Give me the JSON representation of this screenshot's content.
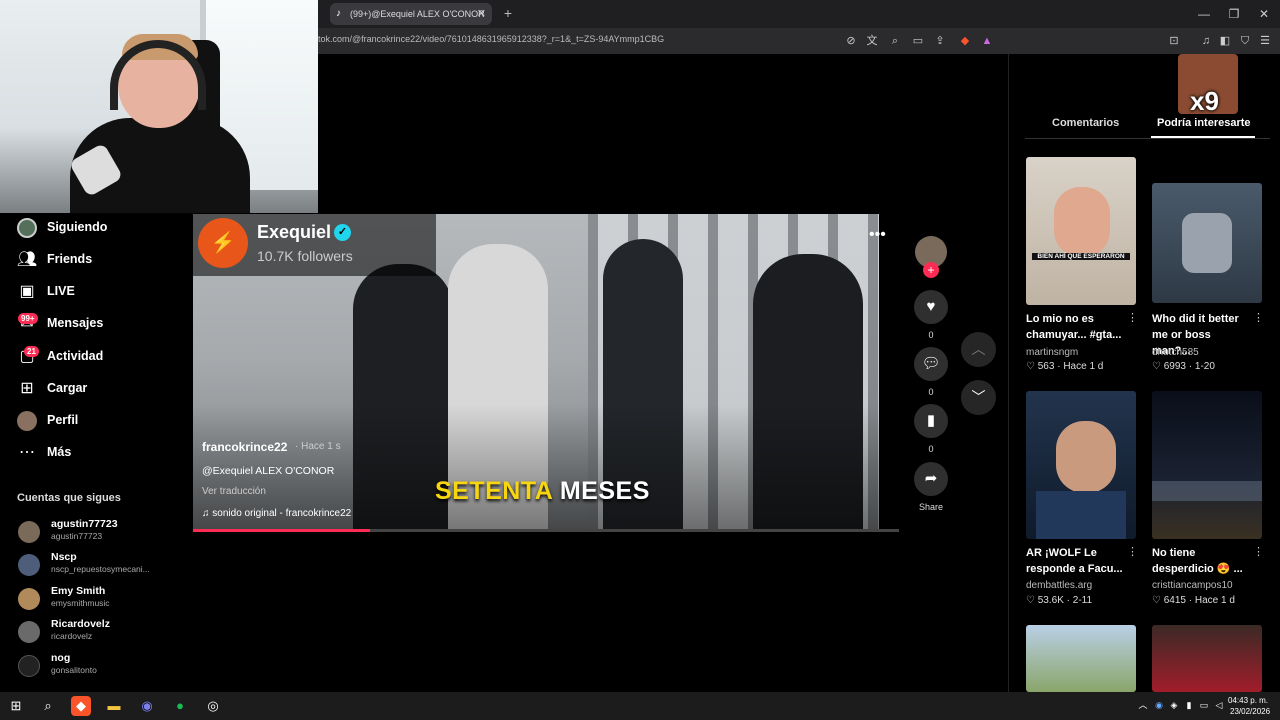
{
  "browser": {
    "tab_title": "(99+)@Exequiel ALEX O'CONOR",
    "url": "tok.com/@francokrince22/video/7610148631965912338?_r=1&_t=ZS-94AYmmp1CBG"
  },
  "nav": {
    "items": [
      {
        "label": "Siguiendo",
        "icon": "following-avatar-icon"
      },
      {
        "label": "Friends",
        "icon": "friends-icon"
      },
      {
        "label": "LIVE",
        "icon": "live-icon"
      },
      {
        "label": "Mensajes",
        "icon": "messages-icon",
        "badge": "99+"
      },
      {
        "label": "Actividad",
        "icon": "activity-icon",
        "badge": "21"
      },
      {
        "label": "Cargar",
        "icon": "upload-icon"
      },
      {
        "label": "Perfil",
        "icon": "profile-avatar-icon"
      },
      {
        "label": "Más",
        "icon": "more-icon"
      }
    ],
    "following_title": "Cuentas que sigues",
    "accounts": [
      {
        "name": "agustin77723",
        "handle": "agustin77723"
      },
      {
        "name": "Nscp",
        "handle": "nscp_repuestosymecani..."
      },
      {
        "name": "Emy Smith",
        "handle": "emysmithmusic"
      },
      {
        "name": "Ricardovelz",
        "handle": "ricardovelz"
      },
      {
        "name": "nog",
        "handle": "gonsalitonto"
      }
    ]
  },
  "video": {
    "channel_name": "Exequiel",
    "channel_followers": "10.7K followers",
    "subtitle_word1": "SETENTA",
    "subtitle_word2": "MESES",
    "author": "francokrince22",
    "time": "· Hace 1 s",
    "caption": "@Exequiel ALEX O'CONOR",
    "translate": "Ver traducción",
    "sound": "sonido original - francokrince22",
    "progress": 0.25
  },
  "actions": {
    "likes": "0",
    "comments": "0",
    "saves": "0",
    "share": "Share"
  },
  "right_panel": {
    "tab_comments": "Comentarios",
    "tab_interest": "Podría interesarte",
    "overlay_text": "x9",
    "cards": [
      {
        "title": "Lo mio no es chamuyar... #gta...",
        "user": "martinsngm",
        "likes": "563",
        "time": "Hace 1 d",
        "thumb_text": "BIEN AHÍ QUE ESPERARON"
      },
      {
        "title": "Who did it better me or boss man?...",
        "user": "dhutch585",
        "likes": "6993",
        "time": "1-20",
        "thumb_text": ""
      },
      {
        "title": "AR ¡WOLF Le responde a Facu...",
        "user": "dembattles.arg",
        "likes": "53.6K",
        "time": "2-11",
        "thumb_text": ""
      },
      {
        "title": "No tiene desperdicio 😍 ...",
        "user": "cristtiancampos10",
        "likes": "6415",
        "time": "Hace 1 d",
        "thumb_text": ""
      }
    ]
  },
  "taskbar": {
    "time": "04:43 p. m.",
    "date": "23/02/2026"
  },
  "colors": {
    "accent": "#fe2c55",
    "verified": "#20d5ec",
    "subtitle": "#f7d50f"
  }
}
